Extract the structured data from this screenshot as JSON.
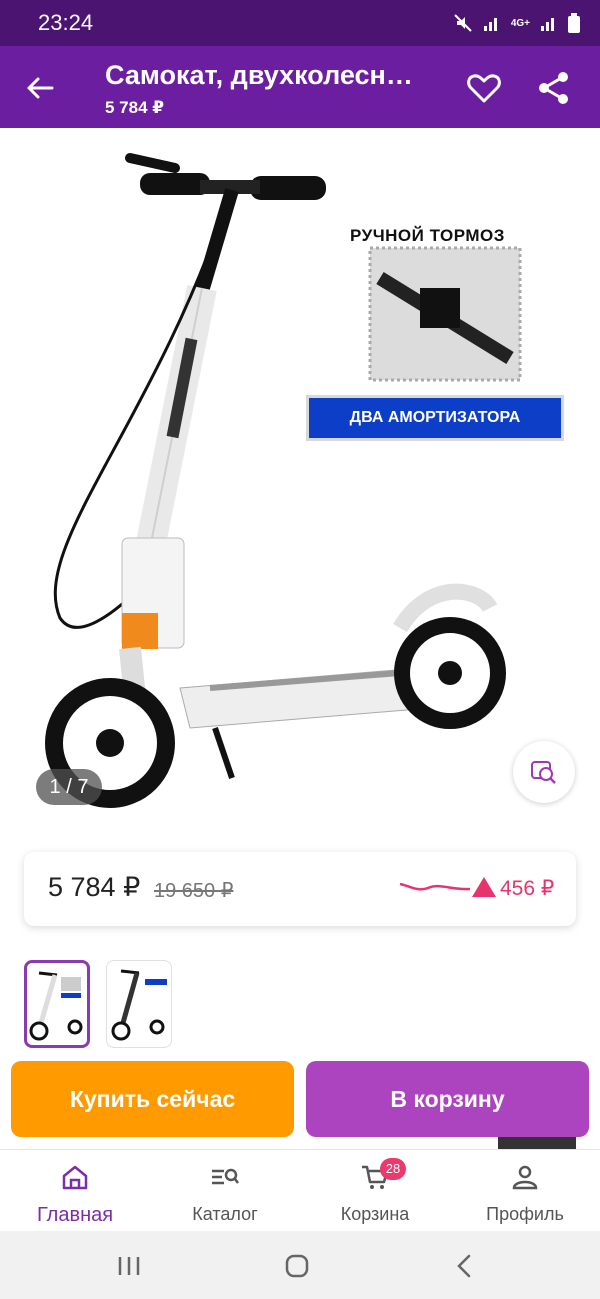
{
  "status_bar": {
    "time": "23:24",
    "network": "4G+"
  },
  "app_bar": {
    "title": "Самокат, двухколесн…",
    "price": "5 784 ₽"
  },
  "gallery": {
    "counter": "1 / 7",
    "promo_title": "РУЧНОЙ ТОРМОЗ",
    "promo_badge": "ДВА АМОРТИЗАТОРА"
  },
  "price_card": {
    "price": "5 784 ₽",
    "old_price": "19 650 ₽",
    "delta": "456 ₽"
  },
  "buttons": {
    "buy_now": "Купить сейчас",
    "add_to_cart": "В корзину"
  },
  "bottom_nav": {
    "home": "Главная",
    "catalog": "Каталог",
    "cart": "Корзина",
    "cart_count": "28",
    "profile": "Профиль"
  },
  "colors": {
    "primary": "#6b1fa0",
    "status_bar": "#4b1470",
    "buy": "#ff9a00",
    "cart": "#ac44c0",
    "accent": "#e8346d"
  }
}
